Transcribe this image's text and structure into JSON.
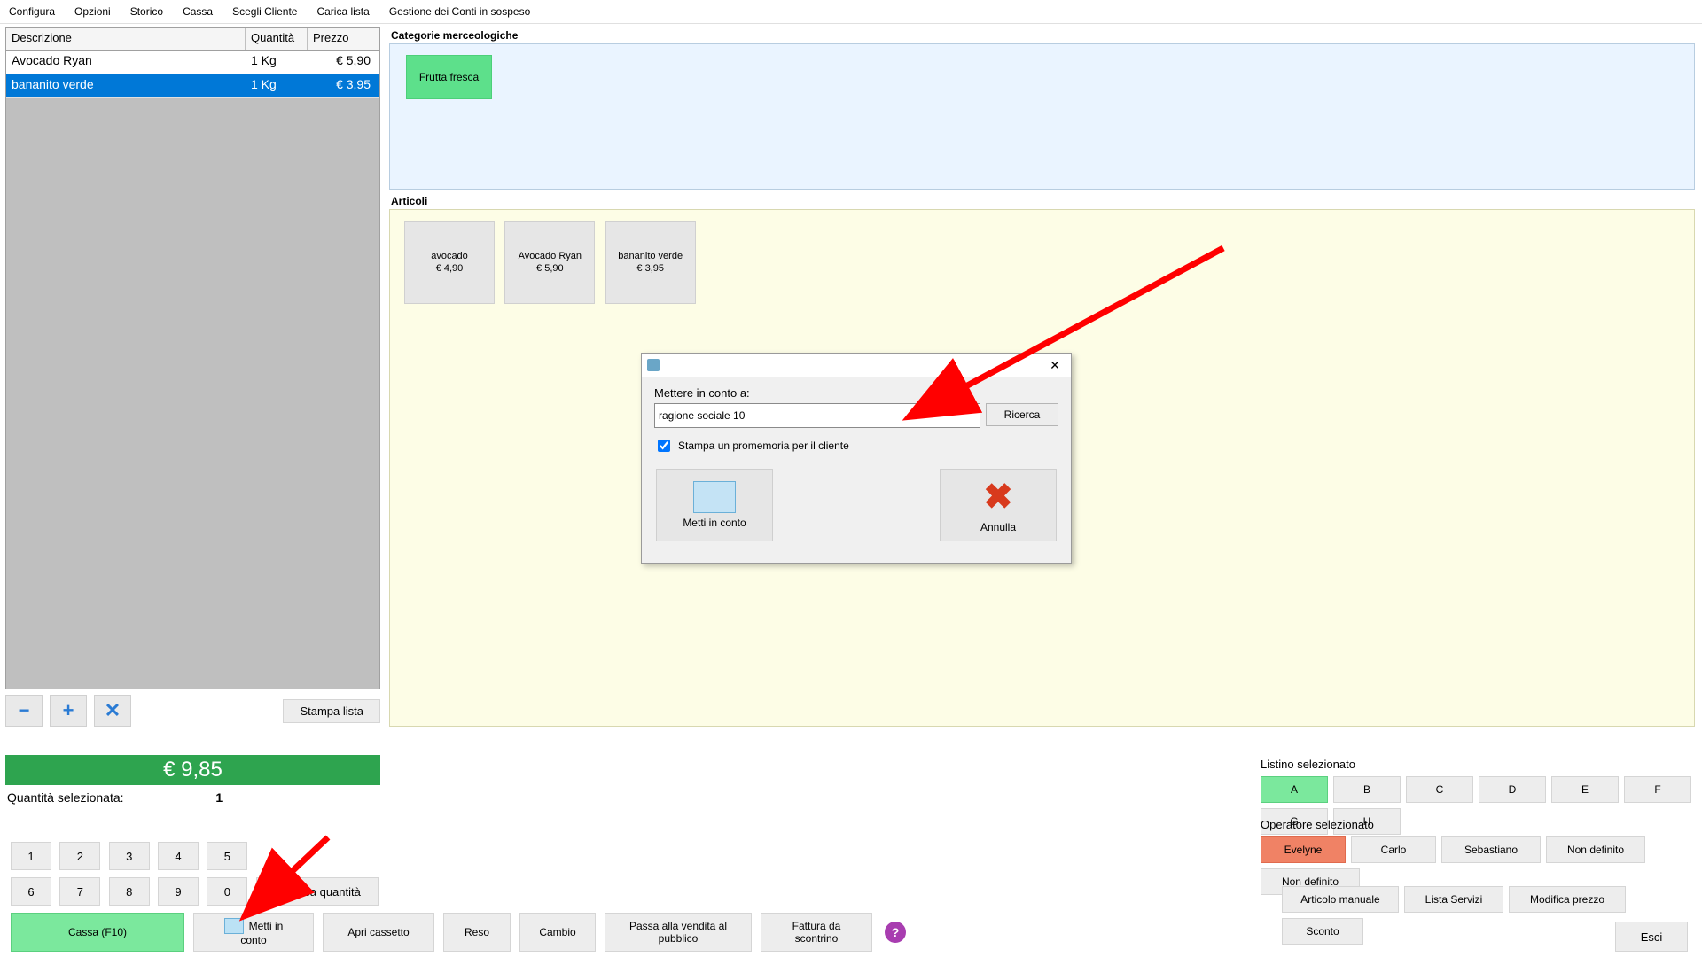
{
  "menu": {
    "items": [
      "Configura",
      "Opzioni",
      "Storico",
      "Cassa",
      "Scegli Cliente",
      "Carica lista",
      "Gestione dei Conti in sospeso"
    ]
  },
  "grid": {
    "headers": {
      "desc": "Descrizione",
      "qty": "Quantità",
      "price": "Prezzo"
    },
    "rows": [
      {
        "desc": "Avocado Ryan",
        "qty": "1 Kg",
        "price": "€ 5,90",
        "selected": false
      },
      {
        "desc": "bananito verde",
        "qty": "1 Kg",
        "price": "€ 3,95",
        "selected": true
      }
    ]
  },
  "left_actions": {
    "stampa": "Stampa lista"
  },
  "categories": {
    "title": "Categorie merceologiche",
    "items": [
      "Frutta fresca"
    ]
  },
  "articles": {
    "title": "Articoli",
    "items": [
      {
        "name": "avocado",
        "price": "€ 4,90"
      },
      {
        "name": "Avocado Ryan",
        "price": "€ 5,90"
      },
      {
        "name": "bananito verde",
        "price": "€ 3,95"
      }
    ]
  },
  "total": "€ 9,85",
  "selected_qty": {
    "label": "Quantità selezionata:",
    "value": "1"
  },
  "keypad": {
    "row1": [
      "1",
      "2",
      "3",
      "4",
      "5"
    ],
    "row2": [
      "6",
      "7",
      "8",
      "9",
      "0"
    ],
    "modify": "Modifica quantità"
  },
  "bottom": {
    "cassa": "Cassa (F10)",
    "metti_conto_l1": "Metti in",
    "metti_conto_l2": "conto",
    "apri_cassetto": "Apri cassetto",
    "reso": "Reso",
    "cambio": "Cambio",
    "passa_l1": "Passa alla vendita al",
    "passa_l2": "pubblico",
    "fattura_l1": "Fattura da",
    "fattura_l2": "scontrino"
  },
  "listino": {
    "title": "Listino selezionato",
    "items": [
      "A",
      "B",
      "C",
      "D",
      "E",
      "F",
      "G",
      "H"
    ],
    "active": "A"
  },
  "operatore": {
    "title": "Operatore selezionato",
    "items": [
      "Evelyne",
      "Carlo",
      "Sebastiano",
      "Non definito",
      "Non definito"
    ],
    "active": "Evelyne"
  },
  "extra": [
    "Articolo manuale",
    "Lista Servizi",
    "Modifica prezzo",
    "Sconto"
  ],
  "exit": "Esci",
  "modal": {
    "label": "Mettere in conto a:",
    "input_value": "ragione sociale 10",
    "search": "Ricerca",
    "chk_label": "Stampa un promemoria per il cliente",
    "ok": "Metti in conto",
    "cancel": "Annulla"
  }
}
